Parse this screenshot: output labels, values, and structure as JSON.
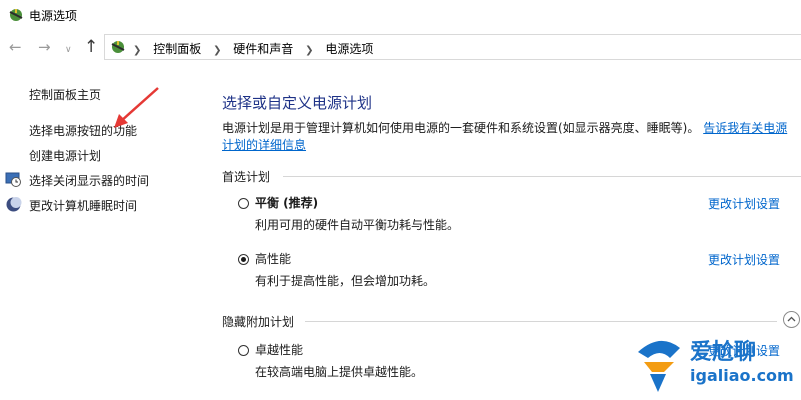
{
  "window": {
    "title": "电源选项"
  },
  "nav": {
    "back_icon": "arrow-left-icon",
    "forward_icon": "arrow-right-icon",
    "up_icon": "arrow-up-icon"
  },
  "breadcrumb": [
    "控制面板",
    "硬件和声音",
    "电源选项"
  ],
  "sidebar": {
    "items": [
      "控制面板主页",
      "选择电源按钮的功能",
      "创建电源计划",
      "选择关闭显示器的时间",
      "更改计算机睡眠时间"
    ]
  },
  "main": {
    "heading": "选择或自定义电源计划",
    "description": "电源计划是用于管理计算机如何使用电源的一套硬件和系统设置(如显示器亮度、睡眠等)。",
    "description_link": "告诉我有关电源计划的详细信息",
    "preferred_label": "首选计划",
    "hidden_label": "隐藏附加计划",
    "plans": [
      {
        "name": "平衡 (推荐)",
        "desc": "利用可用的硬件自动平衡功耗与性能。",
        "link": "更改计划设置",
        "selected": false
      },
      {
        "name": "高性能",
        "desc": "有利于提高性能，但会增加功耗。",
        "link": "更改计划设置",
        "selected": true
      },
      {
        "name": "卓越性能",
        "desc": "在较高端电脑上提供卓越性能。",
        "link": "更改计划设置",
        "selected": false
      }
    ]
  },
  "watermark": {
    "title": "爱尬聊",
    "url": "igaliao.com"
  },
  "colors": {
    "link": "#0066cc",
    "heading": "#1e3287",
    "annotation_arrow": "#e53935",
    "watermark_blue": "#1a73c9",
    "watermark_orange": "#f39c12"
  }
}
